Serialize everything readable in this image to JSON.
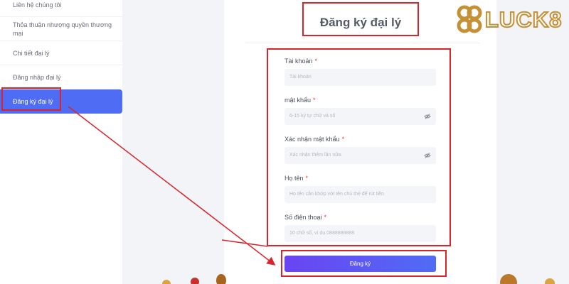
{
  "sidebar": {
    "items": [
      {
        "label": "Liên hệ chúng tôi"
      },
      {
        "label": "Thỏa thuận nhượng quyền thương mại"
      },
      {
        "label": "Chi tiết đại lý"
      },
      {
        "label": "Đăng nhập đại lý"
      },
      {
        "label": "Đăng ký đại lý",
        "active": true
      }
    ]
  },
  "form": {
    "title": "Đăng ký đại lý",
    "required_mark": "*",
    "fields": [
      {
        "label": "Tài khoản",
        "placeholder": "Tài khoản"
      },
      {
        "label": "mật khẩu",
        "placeholder": "6-15 ký tự chữ và số",
        "icon": "eye-off-icon"
      },
      {
        "label": "Xác nhận mật khẩu",
        "placeholder": "Xác nhận thêm lần nữa",
        "icon": "eye-off-icon"
      },
      {
        "label": "Họ tên",
        "placeholder": "Họ tên cần khớp với tên chủ thẻ để rút tiền"
      },
      {
        "label": "Số điện thoại",
        "placeholder": "10 chữ số, ví dụ 0888888888"
      }
    ],
    "submit_label": "Đăng ký"
  },
  "logo": {
    "text": "LUCK8"
  },
  "colors": {
    "accent": "#4f6cf5",
    "annotation": "#d9242b",
    "logo_gold": "#c69034"
  }
}
